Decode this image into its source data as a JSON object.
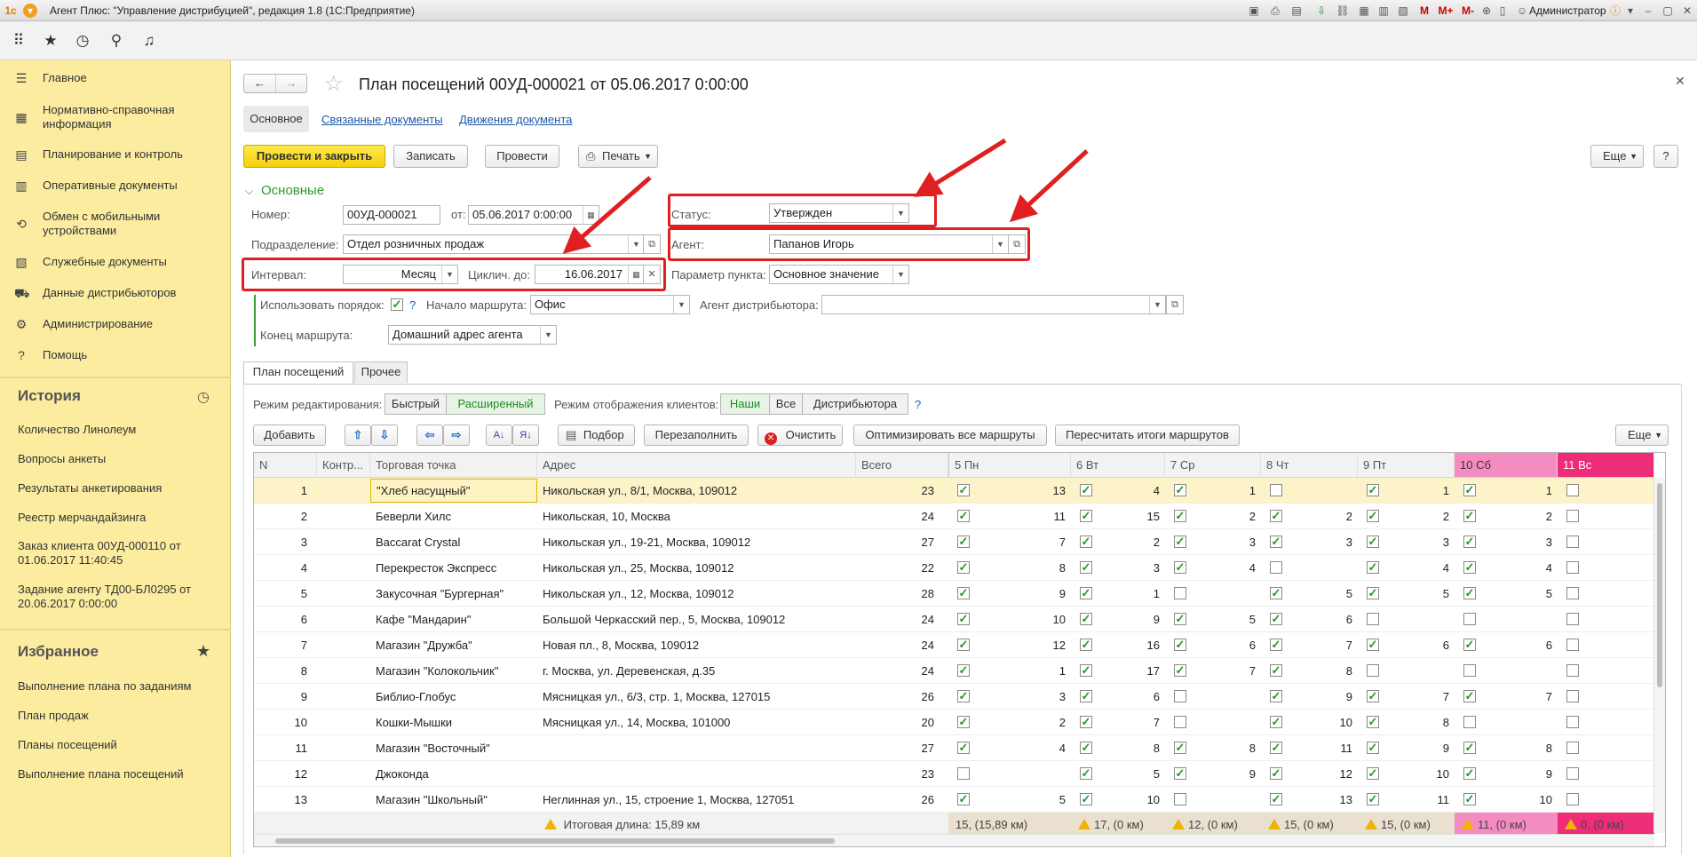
{
  "window": {
    "title": "Агент Плюс: \"Управление дистрибуцией\", редакция 1.8  (1С:Предприятие)",
    "user": "Администратор"
  },
  "title_tools": [
    "M",
    "M+",
    "M-"
  ],
  "sidebar": {
    "nav": [
      {
        "icon": "menu-icon",
        "glyph": "☰",
        "label": "Главное"
      },
      {
        "icon": "reference-icon",
        "glyph": "▦",
        "label": "Нормативно-справочная информация"
      },
      {
        "icon": "planning-icon",
        "glyph": "▤",
        "label": "Планирование и контроль"
      },
      {
        "icon": "documents-icon",
        "glyph": "▥",
        "label": "Оперативные документы"
      },
      {
        "icon": "sync-icon",
        "glyph": "⟲",
        "label": "Обмен с мобильными устройствами"
      },
      {
        "icon": "service-docs-icon",
        "glyph": "▧",
        "label": "Служебные документы"
      },
      {
        "icon": "distributor-icon",
        "glyph": "⛟",
        "label": "Данные дистрибьюторов"
      },
      {
        "icon": "gear-icon",
        "glyph": "⚙",
        "label": "Администрирование"
      },
      {
        "icon": "help-icon",
        "glyph": "?",
        "label": "Помощь"
      }
    ],
    "history_title": "История",
    "history": [
      "Количество Линолеум",
      "Вопросы анкеты",
      "Результаты анкетирования",
      "Реестр мерчандайзинга",
      "Заказ клиента 00УД-000110 от 01.06.2017 11:40:45",
      "Задание агенту ТД00-БЛ0295 от 20.06.2017 0:00:00"
    ],
    "favorites_title": "Избранное",
    "favorites": [
      "Выполнение плана по заданиям",
      "План продаж",
      "Планы посещений",
      "Выполнение плана посещений"
    ]
  },
  "doc": {
    "title": "План посещений 00УД-000021 от 05.06.2017 0:00:00",
    "tabs": {
      "main": "Основное",
      "related": "Связанные документы",
      "movements": "Движения документа"
    },
    "buttons": {
      "post_close": "Провести и закрыть",
      "save": "Записать",
      "post": "Провести",
      "print": "Печать",
      "more": "Еще"
    },
    "section": "Основные",
    "fields": {
      "number_label": "Номер:",
      "number": "00УД-000021",
      "date_label": "от:",
      "date": "05.06.2017  0:00:00",
      "status_label": "Статус:",
      "status": "Утвержден",
      "dept_label": "Подразделение:",
      "dept": "Отдел розничных продаж",
      "agent_label": "Агент:",
      "agent": "Папанов Игорь",
      "interval_label": "Интервал:",
      "interval": "Месяц",
      "cycle_label": "Циклич. до:",
      "cycle": "16.06.2017",
      "point_param_label": "Параметр пункта:",
      "point_param": "Основное значение",
      "use_order_label": "Использовать порядок:",
      "use_order": true,
      "route_start_label": "Начало маршрута:",
      "route_start": "Офис",
      "dist_agent_label": "Агент дистрибьютора:",
      "dist_agent": "",
      "route_end_label": "Конец маршрута:",
      "route_end": "Домашний адрес агента"
    }
  },
  "plan": {
    "tabs": [
      "План посещений",
      "Прочее"
    ],
    "edit_mode_label": "Режим редактирования:",
    "edit_modes": [
      "Быстрый",
      "Расширенный"
    ],
    "client_mode_label": "Режим отображения клиентов:",
    "client_modes": [
      "Наши",
      "Все",
      "Дистрибьютора"
    ],
    "buttons": {
      "add": "Добавить",
      "selection": "Подбор",
      "refill": "Перезаполнить",
      "clear": "Очистить",
      "optimize": "Оптимизировать все маршруты",
      "recalc": "Пересчитать итоги маршрутов",
      "more": "Еще"
    },
    "columns": {
      "n": "N",
      "contr": "Контр...",
      "outlet": "Торговая точка",
      "address": "Адрес",
      "total": "Всего"
    },
    "days": [
      {
        "label": "5 Пн",
        "color": "#f2f2f2"
      },
      {
        "label": "6 Вт",
        "color": "#f2f2f2"
      },
      {
        "label": "7 Ср",
        "color": "#f2f2f2"
      },
      {
        "label": "8 Чт",
        "color": "#f2f2f2"
      },
      {
        "label": "9 Пт",
        "color": "#f2f2f2"
      },
      {
        "label": "10 Сб",
        "color": "#f58cc1"
      },
      {
        "label": "11 Вс",
        "color": "#ee2d78"
      }
    ],
    "rows": [
      {
        "n": "1",
        "outlet": "\"Хлеб насущный\"",
        "address": "Никольская ул., 8/1, Москва, 109012",
        "total": "23",
        "days": [
          [
            true,
            "13"
          ],
          [
            true,
            "4"
          ],
          [
            true,
            "1"
          ],
          [
            false,
            ""
          ],
          [
            true,
            "1"
          ],
          [
            true,
            "1"
          ],
          [
            false,
            ""
          ]
        ]
      },
      {
        "n": "2",
        "outlet": "Беверли Хилс",
        "address": "Никольская, 10, Москва",
        "total": "24",
        "days": [
          [
            true,
            "11"
          ],
          [
            true,
            "15"
          ],
          [
            true,
            "2"
          ],
          [
            true,
            "2"
          ],
          [
            true,
            "2"
          ],
          [
            true,
            "2"
          ],
          [
            false,
            ""
          ]
        ]
      },
      {
        "n": "3",
        "outlet": "Baccarat Crystal",
        "address": "Никольская ул., 19-21, Москва, 109012",
        "total": "27",
        "days": [
          [
            true,
            "7"
          ],
          [
            true,
            "2"
          ],
          [
            true,
            "3"
          ],
          [
            true,
            "3"
          ],
          [
            true,
            "3"
          ],
          [
            true,
            "3"
          ],
          [
            false,
            ""
          ]
        ]
      },
      {
        "n": "4",
        "outlet": "Перекресток Экспресс",
        "address": "Никольская ул., 25, Москва, 109012",
        "total": "22",
        "days": [
          [
            true,
            "8"
          ],
          [
            true,
            "3"
          ],
          [
            true,
            "4"
          ],
          [
            false,
            ""
          ],
          [
            true,
            "4"
          ],
          [
            true,
            "4"
          ],
          [
            false,
            ""
          ]
        ]
      },
      {
        "n": "5",
        "outlet": "Закусочная \"Бургерная\"",
        "address": "Никольская ул., 12, Москва, 109012",
        "total": "28",
        "days": [
          [
            true,
            "9"
          ],
          [
            true,
            "1"
          ],
          [
            false,
            ""
          ],
          [
            true,
            "5"
          ],
          [
            true,
            "5"
          ],
          [
            true,
            "5"
          ],
          [
            false,
            ""
          ]
        ]
      },
      {
        "n": "6",
        "outlet": "Кафе \"Мандарин\"",
        "address": "Большой Черкасский пер., 5, Москва, 109012",
        "total": "24",
        "days": [
          [
            true,
            "10"
          ],
          [
            true,
            "9"
          ],
          [
            true,
            "5"
          ],
          [
            true,
            "6"
          ],
          [
            false,
            ""
          ],
          [
            false,
            ""
          ],
          [
            false,
            ""
          ]
        ]
      },
      {
        "n": "7",
        "outlet": "Магазин \"Дружба\"",
        "address": "Новая пл., 8, Москва, 109012",
        "total": "24",
        "days": [
          [
            true,
            "12"
          ],
          [
            true,
            "16"
          ],
          [
            true,
            "6"
          ],
          [
            true,
            "7"
          ],
          [
            true,
            "6"
          ],
          [
            true,
            "6"
          ],
          [
            false,
            ""
          ]
        ]
      },
      {
        "n": "8",
        "outlet": "Магазин \"Колокольчик\"",
        "address": "г. Москва, ул. Деревенская, д.35",
        "total": "24",
        "days": [
          [
            true,
            "1"
          ],
          [
            true,
            "17"
          ],
          [
            true,
            "7"
          ],
          [
            true,
            "8"
          ],
          [
            false,
            ""
          ],
          [
            false,
            ""
          ],
          [
            false,
            ""
          ]
        ]
      },
      {
        "n": "9",
        "outlet": "Библио-Глобус",
        "address": "Мясницкая ул., 6/3, стр. 1, Москва, 127015",
        "total": "26",
        "days": [
          [
            true,
            "3"
          ],
          [
            true,
            "6"
          ],
          [
            false,
            ""
          ],
          [
            true,
            "9"
          ],
          [
            true,
            "7"
          ],
          [
            true,
            "7"
          ],
          [
            false,
            ""
          ]
        ]
      },
      {
        "n": "10",
        "outlet": "Кошки-Мышки",
        "address": "Мясницкая ул., 14, Москва, 101000",
        "total": "20",
        "days": [
          [
            true,
            "2"
          ],
          [
            true,
            "7"
          ],
          [
            false,
            ""
          ],
          [
            true,
            "10"
          ],
          [
            true,
            "8"
          ],
          [
            false,
            ""
          ],
          [
            false,
            ""
          ]
        ]
      },
      {
        "n": "11",
        "outlet": "Магазин \"Восточный\"",
        "address": "",
        "total": "27",
        "days": [
          [
            true,
            "4"
          ],
          [
            true,
            "8"
          ],
          [
            true,
            "8"
          ],
          [
            true,
            "11"
          ],
          [
            true,
            "9"
          ],
          [
            true,
            "8"
          ],
          [
            false,
            ""
          ]
        ]
      },
      {
        "n": "12",
        "outlet": "Джоконда",
        "address": "",
        "total": "23",
        "days": [
          [
            false,
            ""
          ],
          [
            true,
            "5"
          ],
          [
            true,
            "9"
          ],
          [
            true,
            "12"
          ],
          [
            true,
            "10"
          ],
          [
            true,
            "9"
          ],
          [
            false,
            ""
          ]
        ]
      },
      {
        "n": "13",
        "outlet": "Магазин \"Школьный\"",
        "address": "Неглинная ул., 15, строение 1, Москва, 127051",
        "total": "26",
        "days": [
          [
            true,
            "5"
          ],
          [
            true,
            "10"
          ],
          [
            false,
            ""
          ],
          [
            true,
            "13"
          ],
          [
            true,
            "11"
          ],
          [
            true,
            "10"
          ],
          [
            false,
            ""
          ]
        ]
      }
    ],
    "footer": {
      "total_length": "Итоговая длина: 15,89 км",
      "days": [
        "15, (15,89 км)",
        "17, (0 км)",
        "12, (0 км)",
        "15, (0 км)",
        "15, (0 км)",
        "11, (0 км)",
        "0, (0 км)"
      ]
    }
  },
  "colors": {
    "accent_green": "#1d9a2a",
    "sidebar": "#fbec9f",
    "primary_button": "#f4cf0d",
    "annotation": "#e02020"
  }
}
